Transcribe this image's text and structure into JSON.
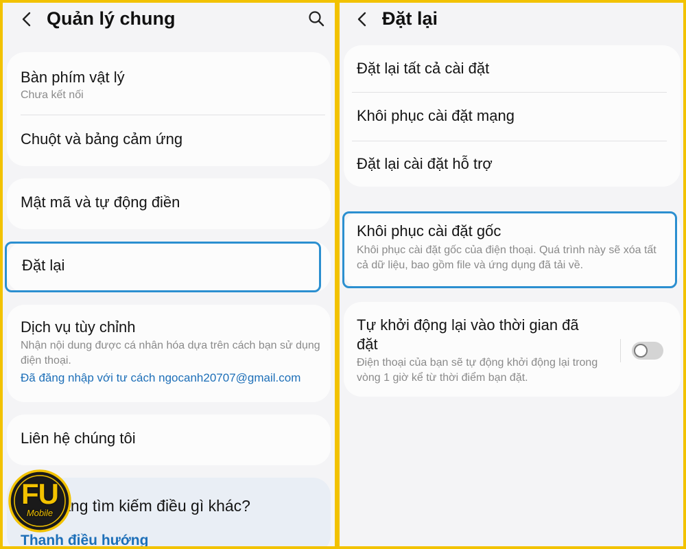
{
  "left": {
    "title": "Quản lý chung",
    "items": [
      {
        "title": "Bàn phím vật lý",
        "subtitle": "Chưa kết nối"
      },
      {
        "title": "Chuột và bảng cảm ứng"
      },
      {
        "title": "Mật mã và tự động điền"
      },
      {
        "title": "Đặt lại"
      },
      {
        "title": "Dịch vụ tùy chỉnh",
        "subtitle": "Nhận nội dung được cá nhân hóa dựa trên cách bạn sử dụng điện thoại.",
        "link": "Đã đăng nhập với tư cách ngocanh20707@gmail.com"
      },
      {
        "title": "Liên hệ chúng tôi"
      }
    ],
    "search_prompt": {
      "title": "Bạn đang tìm kiếm điều gì khác?",
      "link": "Thanh điều hướng"
    }
  },
  "right": {
    "title": "Đặt lại",
    "items": [
      {
        "title": "Đặt lại tất cả cài đặt"
      },
      {
        "title": "Khôi phục cài đặt mạng"
      },
      {
        "title": "Đặt lại cài đặt hỗ trợ"
      },
      {
        "title": "Khôi phục cài đặt gốc",
        "subtitle": "Khôi phục cài đặt gốc của điện thoại. Quá trình này sẽ xóa tất cả dữ liệu, bao gồm file và ứng dụng đã tải về."
      },
      {
        "title": "Tự khởi động lại vào thời gian đã đặt",
        "subtitle": "Điện thoại của bạn sẽ tự động khởi động lại trong vòng 1 giờ kể từ thời điểm bạn đặt.",
        "toggle_on": false
      }
    ]
  },
  "logo": {
    "main": "FU",
    "sub": "Mobile"
  },
  "colors": {
    "frame": "#f2c200",
    "highlight": "#2b8fd0",
    "link": "#1d6fb8"
  }
}
